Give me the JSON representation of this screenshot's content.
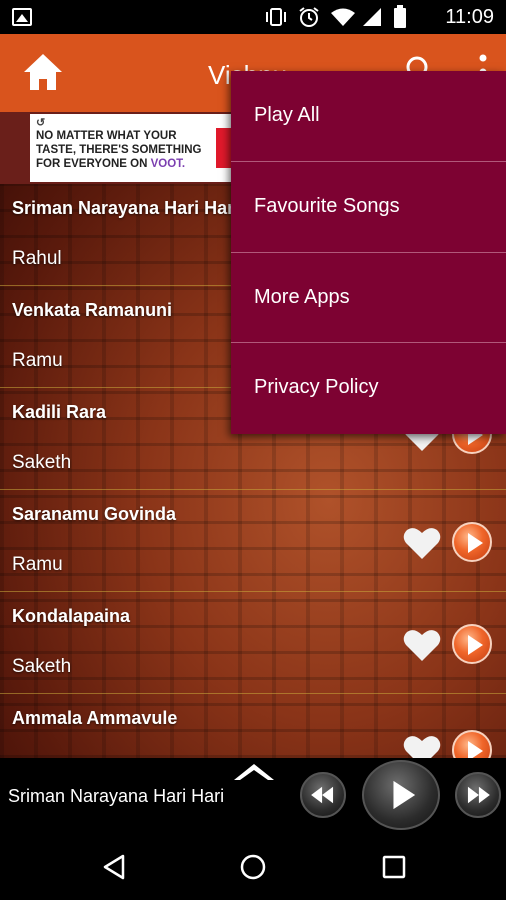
{
  "status_bar": {
    "time": "11:09",
    "icons": [
      "image-icon",
      "vibrate-icon",
      "alarm-icon",
      "wifi-icon",
      "signal-icon",
      "battery-icon"
    ]
  },
  "app_bar": {
    "title": "Vishnu",
    "home_icon": "home-icon",
    "search_icon": "search-icon",
    "overflow_icon": "overflow-menu-icon",
    "color": "#d9541d"
  },
  "ad": {
    "line1": "NO MATTER WHAT YOUR",
    "line2": "TASTE, THERE'S SOMETHING",
    "line3_prefix": "FOR EVERYONE ON ",
    "brand": "VOOT."
  },
  "songs": [
    {
      "title": "Sriman Narayana Hari Hari",
      "artist": "Rahul"
    },
    {
      "title": "Venkata Ramanuni",
      "artist": "Ramu"
    },
    {
      "title": "Kadili Rara",
      "artist": "Saketh"
    },
    {
      "title": "Saranamu Govinda",
      "artist": "Ramu"
    },
    {
      "title": "Kondalapaina",
      "artist": "Saketh"
    },
    {
      "title": "Ammala Ammavule",
      "artist": ""
    }
  ],
  "menu": {
    "items": [
      "Play All",
      "Favourite Songs",
      "More Apps",
      "Privacy Policy"
    ],
    "color": "#7d0232"
  },
  "player": {
    "now_playing": "Sriman Narayana Hari Hari",
    "controls": [
      "expand-icon",
      "rewind-icon",
      "play-icon",
      "fast-forward-icon"
    ]
  },
  "nav_bar": {
    "buttons": [
      "back-icon",
      "home-circle-icon",
      "recents-icon"
    ]
  }
}
